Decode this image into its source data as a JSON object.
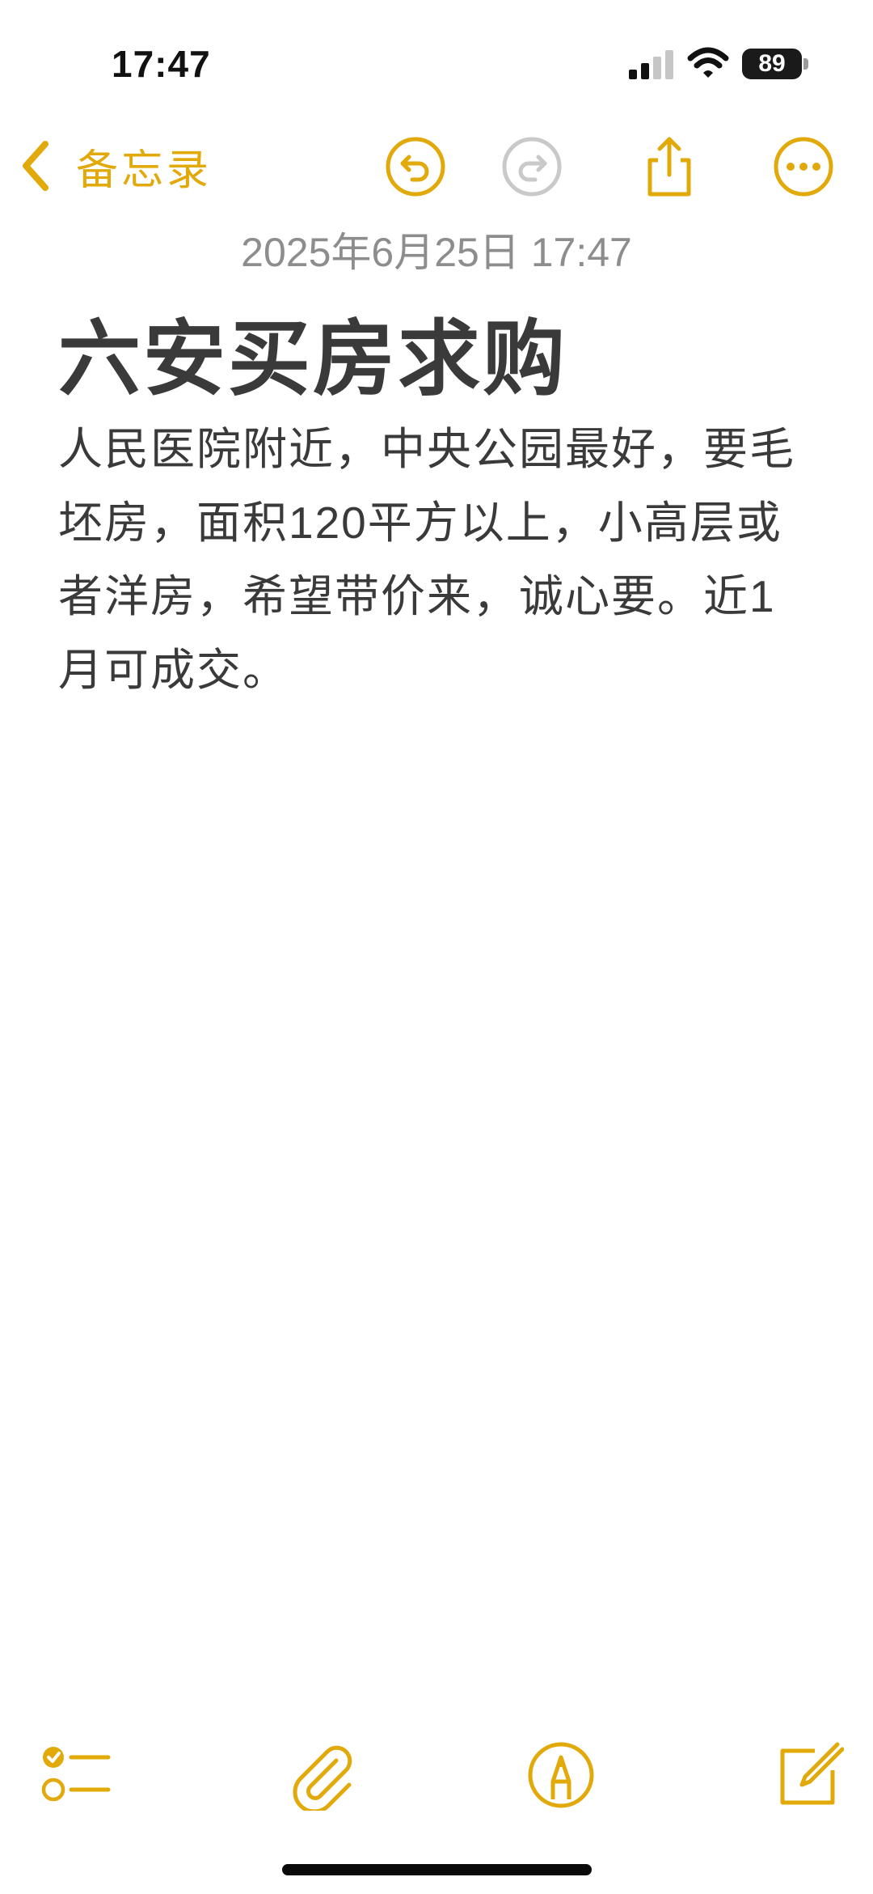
{
  "status_bar": {
    "time": "17:47",
    "battery": "89"
  },
  "nav": {
    "back_label": "备忘录"
  },
  "note": {
    "date": "2025年6月25日 17:47",
    "title": "六安买房求购",
    "body": "人民医院附近，中央公园最好，要毛坯房，面积120平方以上，小高层或者洋房，希望带价来，诚心要。近1月可成交。"
  },
  "colors": {
    "accent": "#e2a90a",
    "disabled": "#c9c9c9",
    "text": "#3a3a3a",
    "date": "#8d8d8d"
  },
  "icons": [
    "undo-icon",
    "redo-icon",
    "share-icon",
    "more-icon",
    "checklist-icon",
    "attachment-icon",
    "markup-icon",
    "compose-icon"
  ]
}
